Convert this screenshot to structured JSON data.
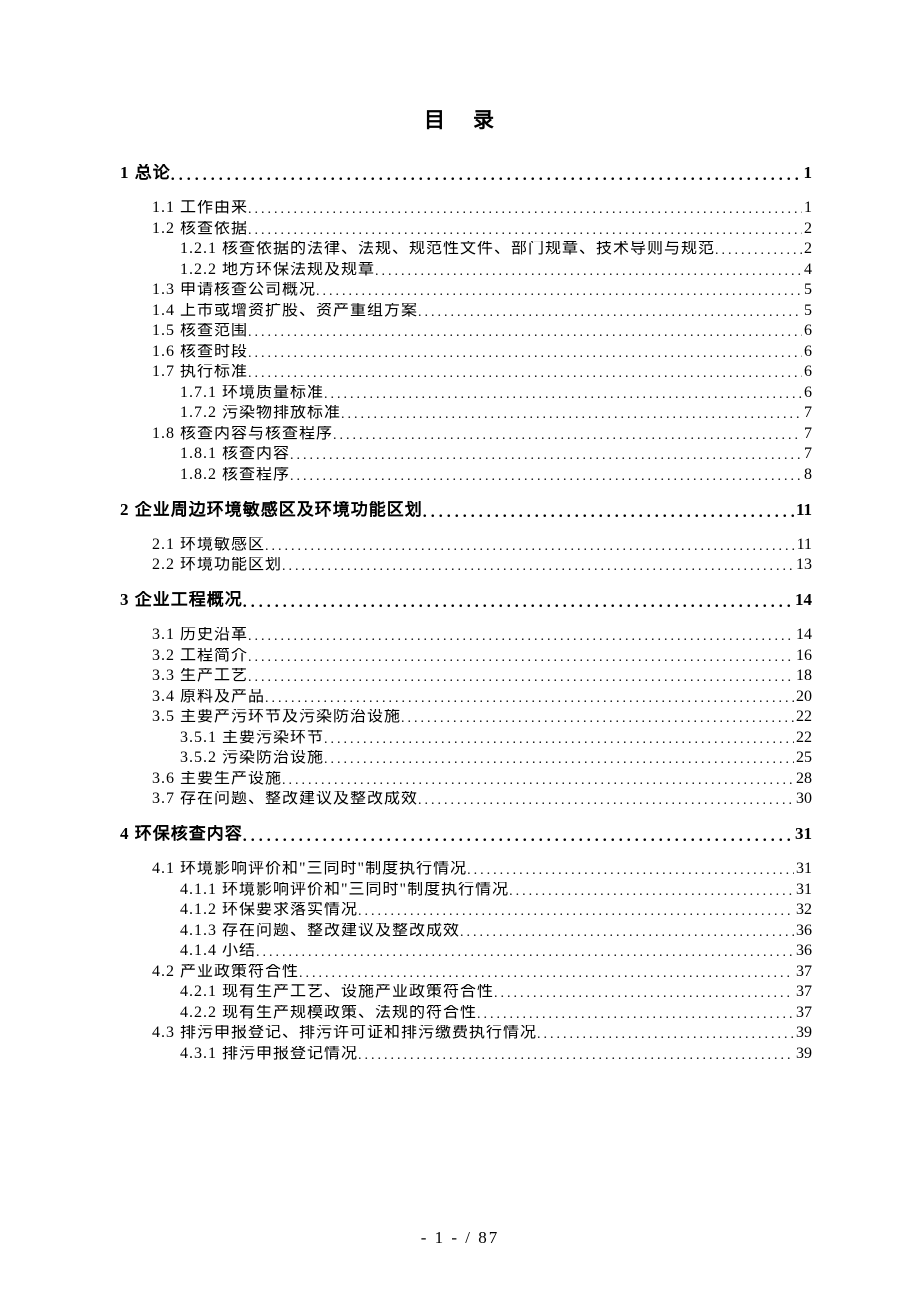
{
  "title": "目录",
  "footer": "- 1 -  / 87",
  "toc": [
    {
      "level": 1,
      "label": "1 总论",
      "page": "1"
    },
    {
      "level": 2,
      "label": "1.1 工作由来",
      "page": "1"
    },
    {
      "level": 2,
      "label": "1.2 核查依据",
      "page": "2"
    },
    {
      "level": 3,
      "label": "1.2.1 核查依据的法律、法规、规范性文件、部门规章、技术导则与规范",
      "page": "2"
    },
    {
      "level": 3,
      "label": "1.2.2 地方环保法规及规章",
      "page": "4"
    },
    {
      "level": 2,
      "label": "1.3 申请核查公司概况",
      "page": "5"
    },
    {
      "level": 2,
      "label": "1.4 上市或增资扩股、资产重组方案",
      "page": "5"
    },
    {
      "level": 2,
      "label": "1.5 核查范围",
      "page": "6"
    },
    {
      "level": 2,
      "label": "1.6 核查时段",
      "page": "6"
    },
    {
      "level": 2,
      "label": "1.7 执行标准",
      "page": "6"
    },
    {
      "level": 3,
      "label": "1.7.1 环境质量标准",
      "page": "6"
    },
    {
      "level": 3,
      "label": "1.7.2 污染物排放标准",
      "page": "7"
    },
    {
      "level": 2,
      "label": "1.8 核查内容与核查程序",
      "page": "7"
    },
    {
      "level": 3,
      "label": "1.8.1 核查内容",
      "page": "7"
    },
    {
      "level": 3,
      "label": "1.8.2 核查程序",
      "page": "8"
    },
    {
      "level": 1,
      "label": "2 企业周边环境敏感区及环境功能区划",
      "page": "11"
    },
    {
      "level": 2,
      "label": "2.1 环境敏感区",
      "page": "11"
    },
    {
      "level": 2,
      "label": "2.2 环境功能区划",
      "page": "13"
    },
    {
      "level": 1,
      "label": "3 企业工程概况",
      "page": "14"
    },
    {
      "level": 2,
      "label": "3.1 历史沿革",
      "page": "14"
    },
    {
      "level": 2,
      "label": "3.2 工程简介",
      "page": "16"
    },
    {
      "level": 2,
      "label": "3.3 生产工艺",
      "page": "18"
    },
    {
      "level": 2,
      "label": "3.4 原料及产品",
      "page": "20"
    },
    {
      "level": 2,
      "label": "3.5 主要产污环节及污染防治设施",
      "page": "22"
    },
    {
      "level": 3,
      "label": "3.5.1 主要污染环节",
      "page": "22"
    },
    {
      "level": 3,
      "label": "3.5.2 污染防治设施",
      "page": "25"
    },
    {
      "level": 2,
      "label": "3.6 主要生产设施",
      "page": "28"
    },
    {
      "level": 2,
      "label": "3.7 存在问题、整改建议及整改成效",
      "page": "30"
    },
    {
      "level": 1,
      "label": "4 环保核查内容",
      "page": "31"
    },
    {
      "level": 2,
      "label": "4.1 环境影响评价和\"三同时\"制度执行情况",
      "page": "31"
    },
    {
      "level": 3,
      "label": "4.1.1 环境影响评价和\"三同时\"制度执行情况",
      "page": "31"
    },
    {
      "level": 3,
      "label": "4.1.2 环保要求落实情况",
      "page": "32"
    },
    {
      "level": 3,
      "label": "4.1.3 存在问题、整改建议及整改成效",
      "page": "36"
    },
    {
      "level": 3,
      "label": "4.1.4 小结",
      "page": "36"
    },
    {
      "level": 2,
      "label": "4.2 产业政策符合性",
      "page": "37"
    },
    {
      "level": 3,
      "label": "4.2.1 现有生产工艺、设施产业政策符合性",
      "page": "37"
    },
    {
      "level": 3,
      "label": "4.2.2 现有生产规模政策、法规的符合性",
      "page": "37"
    },
    {
      "level": 2,
      "label": "4.3 排污申报登记、排污许可证和排污缴费执行情况",
      "page": "39"
    },
    {
      "level": 3,
      "label": "4.3.1 排污申报登记情况",
      "page": "39"
    }
  ]
}
